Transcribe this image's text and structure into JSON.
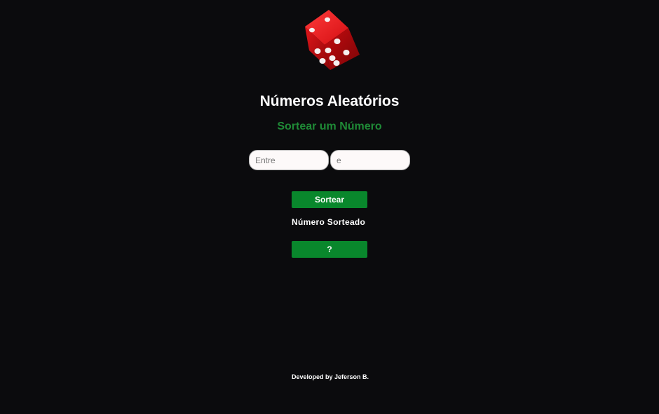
{
  "header": {
    "logo_icon": "dice-icon",
    "title": "Números Aleatórios",
    "subtitle": "Sortear um Número"
  },
  "form": {
    "min_placeholder": "Entre",
    "max_placeholder": "e",
    "min_value": "",
    "max_value": "",
    "draw_button_label": "Sortear"
  },
  "result": {
    "label": "Número Sorteado",
    "value": "?"
  },
  "footer": {
    "credit": "Developed by Jeferson B."
  },
  "colors": {
    "background": "#0b0b0d",
    "accent_green": "#09872c",
    "subtitle_green": "#1f8a36",
    "dice_red": "#d40e12"
  }
}
